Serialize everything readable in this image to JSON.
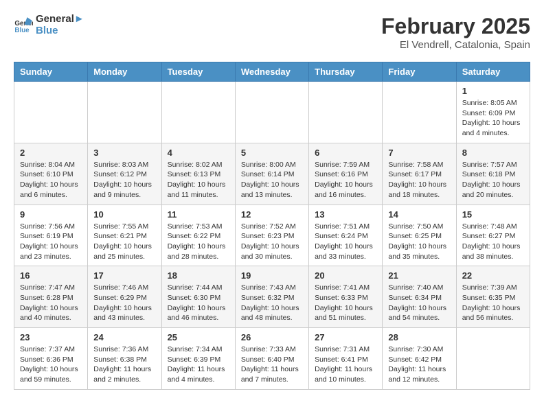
{
  "header": {
    "logo": {
      "line1": "General",
      "line2": "Blue"
    },
    "title": "February 2025",
    "location": "El Vendrell, Catalonia, Spain"
  },
  "days_of_week": [
    "Sunday",
    "Monday",
    "Tuesday",
    "Wednesday",
    "Thursday",
    "Friday",
    "Saturday"
  ],
  "weeks": [
    [
      {
        "day": "",
        "info": ""
      },
      {
        "day": "",
        "info": ""
      },
      {
        "day": "",
        "info": ""
      },
      {
        "day": "",
        "info": ""
      },
      {
        "day": "",
        "info": ""
      },
      {
        "day": "",
        "info": ""
      },
      {
        "day": "1",
        "info": "Sunrise: 8:05 AM\nSunset: 6:09 PM\nDaylight: 10 hours and 4 minutes."
      }
    ],
    [
      {
        "day": "2",
        "info": "Sunrise: 8:04 AM\nSunset: 6:10 PM\nDaylight: 10 hours and 6 minutes."
      },
      {
        "day": "3",
        "info": "Sunrise: 8:03 AM\nSunset: 6:12 PM\nDaylight: 10 hours and 9 minutes."
      },
      {
        "day": "4",
        "info": "Sunrise: 8:02 AM\nSunset: 6:13 PM\nDaylight: 10 hours and 11 minutes."
      },
      {
        "day": "5",
        "info": "Sunrise: 8:00 AM\nSunset: 6:14 PM\nDaylight: 10 hours and 13 minutes."
      },
      {
        "day": "6",
        "info": "Sunrise: 7:59 AM\nSunset: 6:16 PM\nDaylight: 10 hours and 16 minutes."
      },
      {
        "day": "7",
        "info": "Sunrise: 7:58 AM\nSunset: 6:17 PM\nDaylight: 10 hours and 18 minutes."
      },
      {
        "day": "8",
        "info": "Sunrise: 7:57 AM\nSunset: 6:18 PM\nDaylight: 10 hours and 20 minutes."
      }
    ],
    [
      {
        "day": "9",
        "info": "Sunrise: 7:56 AM\nSunset: 6:19 PM\nDaylight: 10 hours and 23 minutes."
      },
      {
        "day": "10",
        "info": "Sunrise: 7:55 AM\nSunset: 6:21 PM\nDaylight: 10 hours and 25 minutes."
      },
      {
        "day": "11",
        "info": "Sunrise: 7:53 AM\nSunset: 6:22 PM\nDaylight: 10 hours and 28 minutes."
      },
      {
        "day": "12",
        "info": "Sunrise: 7:52 AM\nSunset: 6:23 PM\nDaylight: 10 hours and 30 minutes."
      },
      {
        "day": "13",
        "info": "Sunrise: 7:51 AM\nSunset: 6:24 PM\nDaylight: 10 hours and 33 minutes."
      },
      {
        "day": "14",
        "info": "Sunrise: 7:50 AM\nSunset: 6:25 PM\nDaylight: 10 hours and 35 minutes."
      },
      {
        "day": "15",
        "info": "Sunrise: 7:48 AM\nSunset: 6:27 PM\nDaylight: 10 hours and 38 minutes."
      }
    ],
    [
      {
        "day": "16",
        "info": "Sunrise: 7:47 AM\nSunset: 6:28 PM\nDaylight: 10 hours and 40 minutes."
      },
      {
        "day": "17",
        "info": "Sunrise: 7:46 AM\nSunset: 6:29 PM\nDaylight: 10 hours and 43 minutes."
      },
      {
        "day": "18",
        "info": "Sunrise: 7:44 AM\nSunset: 6:30 PM\nDaylight: 10 hours and 46 minutes."
      },
      {
        "day": "19",
        "info": "Sunrise: 7:43 AM\nSunset: 6:32 PM\nDaylight: 10 hours and 48 minutes."
      },
      {
        "day": "20",
        "info": "Sunrise: 7:41 AM\nSunset: 6:33 PM\nDaylight: 10 hours and 51 minutes."
      },
      {
        "day": "21",
        "info": "Sunrise: 7:40 AM\nSunset: 6:34 PM\nDaylight: 10 hours and 54 minutes."
      },
      {
        "day": "22",
        "info": "Sunrise: 7:39 AM\nSunset: 6:35 PM\nDaylight: 10 hours and 56 minutes."
      }
    ],
    [
      {
        "day": "23",
        "info": "Sunrise: 7:37 AM\nSunset: 6:36 PM\nDaylight: 10 hours and 59 minutes."
      },
      {
        "day": "24",
        "info": "Sunrise: 7:36 AM\nSunset: 6:38 PM\nDaylight: 11 hours and 2 minutes."
      },
      {
        "day": "25",
        "info": "Sunrise: 7:34 AM\nSunset: 6:39 PM\nDaylight: 11 hours and 4 minutes."
      },
      {
        "day": "26",
        "info": "Sunrise: 7:33 AM\nSunset: 6:40 PM\nDaylight: 11 hours and 7 minutes."
      },
      {
        "day": "27",
        "info": "Sunrise: 7:31 AM\nSunset: 6:41 PM\nDaylight: 11 hours and 10 minutes."
      },
      {
        "day": "28",
        "info": "Sunrise: 7:30 AM\nSunset: 6:42 PM\nDaylight: 11 hours and 12 minutes."
      },
      {
        "day": "",
        "info": ""
      }
    ]
  ]
}
